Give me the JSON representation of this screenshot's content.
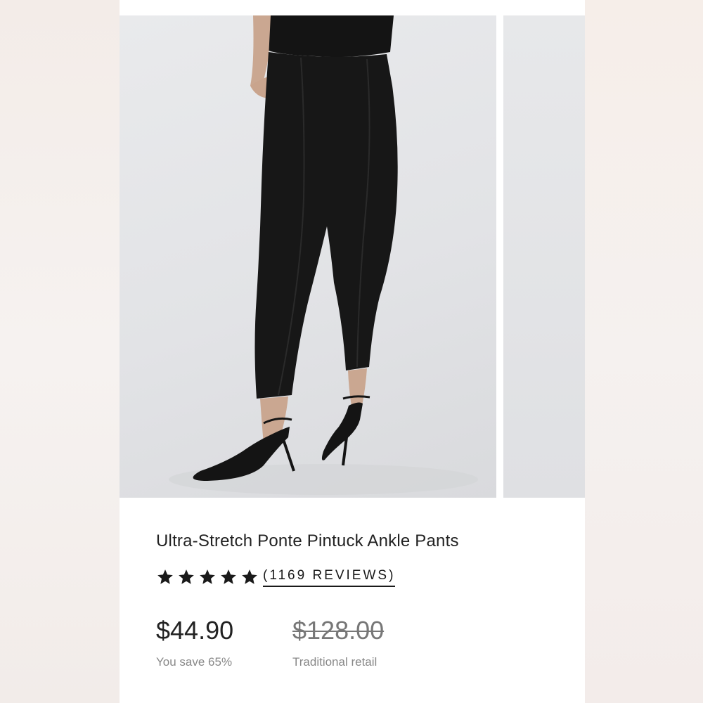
{
  "product": {
    "title": "Ultra-Stretch Ponte Pintuck Ankle Pants",
    "rating": {
      "stars": 5,
      "reviews_label": "(1169 REVIEWS)"
    },
    "price": {
      "current": "$44.90",
      "savings_note": "You save 65%",
      "original": "$128.00",
      "original_note": "Traditional retail"
    }
  },
  "colors": {
    "star": "#1a1a1a",
    "text_primary": "#222222",
    "text_secondary": "#888888",
    "garment": "#171717"
  },
  "icons": {
    "rating": "star-icon"
  }
}
